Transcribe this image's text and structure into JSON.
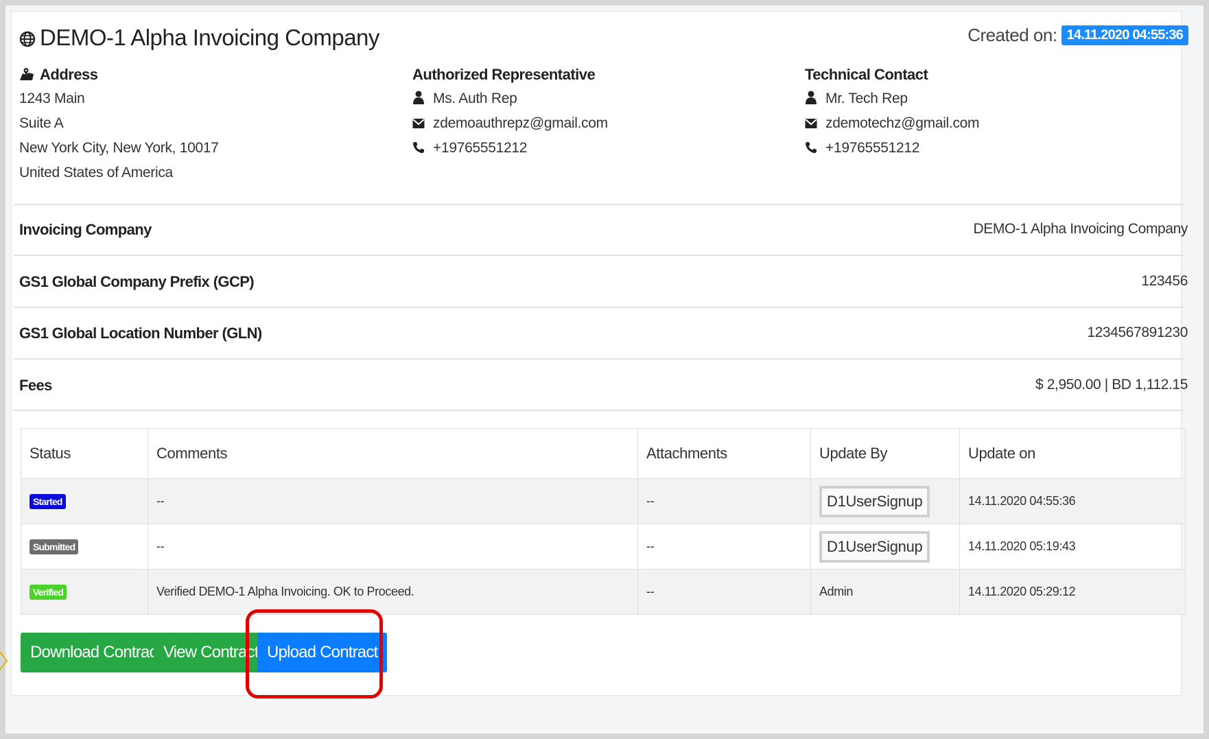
{
  "header": {
    "title": "DEMO-1 Alpha Invoicing Company",
    "created_label": "Created on:",
    "created_value": "14.11.2020 04:55:36"
  },
  "address": {
    "heading": "Address",
    "lines": [
      "1243 Main",
      "Suite A",
      "New York City, New York, 10017",
      "United States of America"
    ]
  },
  "authorized_rep": {
    "heading": "Authorized Representative",
    "name": "Ms. Auth Rep",
    "email": "zdemoauthrepz@gmail.com",
    "phone": "+19765551212"
  },
  "technical_contact": {
    "heading": "Technical Contact",
    "name": "Mr. Tech Rep",
    "email": "zdemotechz@gmail.com",
    "phone": "+19765551212"
  },
  "details": [
    {
      "label": "Invoicing Company",
      "value": "DEMO-1 Alpha Invoicing Company"
    },
    {
      "label": "GS1 Global Company Prefix (GCP)",
      "value": "123456"
    },
    {
      "label": "GS1 Global Location Number (GLN)",
      "value": "1234567891230"
    },
    {
      "label": "Fees",
      "value": "$ 2,950.00 | BD 1,112.15"
    }
  ],
  "history": {
    "columns": [
      "Status",
      "Comments",
      "Attachments",
      "Update By",
      "Update on"
    ],
    "rows": [
      {
        "status": "Started",
        "status_color": "#0a0adb",
        "comment": "--",
        "attachments": "--",
        "update_by": "D1UserSignup",
        "update_on": "14.11.2020 04:55:36"
      },
      {
        "status": "Submitted",
        "status_color": "#6c6c6c",
        "comment": "--",
        "attachments": "--",
        "update_by": "D1UserSignup",
        "update_on": "14.11.2020 05:19:43"
      },
      {
        "status": "Verified",
        "status_color": "#4bd32a",
        "comment": "Verified DEMO-1 Alpha Invoicing. OK to Proceed.",
        "attachments": "--",
        "update_by": "Admin",
        "update_on": "14.11.2020 05:29:12"
      }
    ]
  },
  "actions": {
    "download": "Download Contract",
    "view": "View Contract",
    "upload": "Upload Contract"
  },
  "colors": {
    "accent_blue": "#0d7dff",
    "success_green": "#28a745",
    "highlight_red": "#e10000"
  }
}
